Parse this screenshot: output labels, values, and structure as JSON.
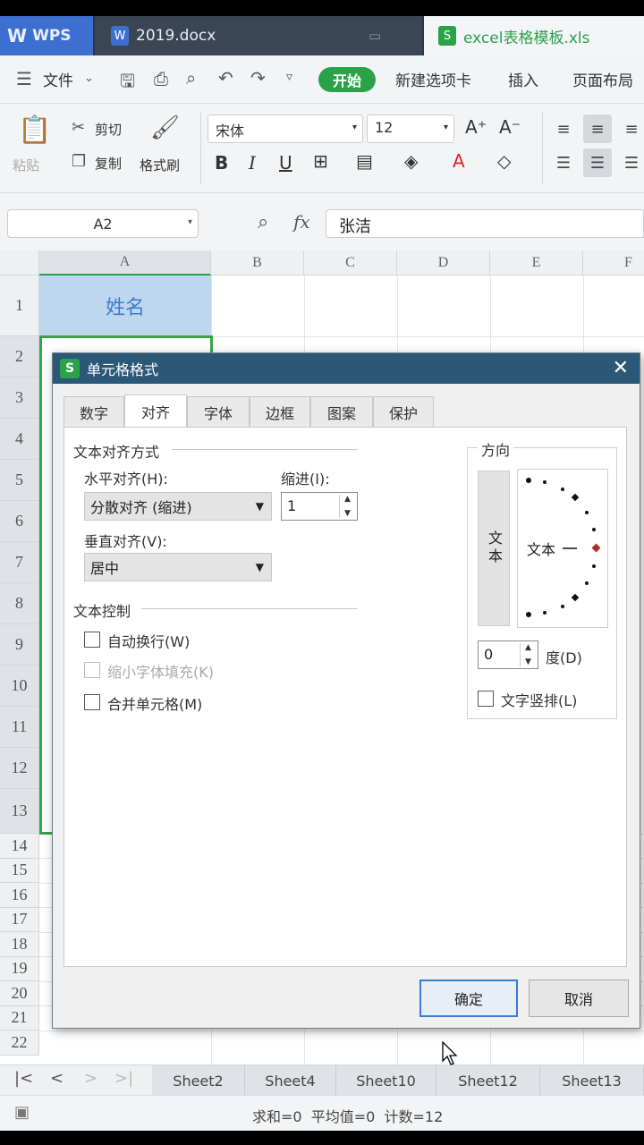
{
  "window_tabs": {
    "wps": "WPS",
    "docx": "2019.docx",
    "xls": "excel表格模板.xls"
  },
  "menubar": {
    "file": "文件",
    "start": "开始",
    "new_tab": "新建选项卡",
    "insert": "插入",
    "page_layout": "页面布局"
  },
  "toolbar": {
    "paste": "粘贴",
    "cut": "剪切",
    "copy": "复制",
    "format_painter": "格式刷",
    "font_name": "宋体",
    "font_size": "12",
    "bold": "B",
    "italic": "I",
    "underline": "U"
  },
  "formula_bar": {
    "cell_ref": "A2",
    "fx": "fx",
    "value": "张洁"
  },
  "sheet": {
    "columns": [
      "A",
      "B",
      "C",
      "D",
      "E",
      "F"
    ],
    "rows": [
      "1",
      "2",
      "3",
      "4",
      "5",
      "6",
      "7",
      "8",
      "9",
      "10",
      "11",
      "12",
      "13",
      "14",
      "15",
      "16",
      "17",
      "18",
      "19",
      "20",
      "21",
      "22"
    ],
    "a1": "姓名"
  },
  "sheet_tabs": [
    "Sheet2",
    "Sheet4",
    "Sheet10",
    "Sheet12",
    "Sheet13"
  ],
  "status": "求和=0  平均值=0  计数=12",
  "dialog": {
    "title": "单元格格式",
    "tabs": [
      "数字",
      "对齐",
      "字体",
      "边框",
      "图案",
      "保护"
    ],
    "text_align_group": "文本对齐方式",
    "h_align_label": "水平对齐(H):",
    "h_align_value": "分散对齐 (缩进)",
    "indent_label": "缩进(I):",
    "indent_value": "1",
    "v_align_label": "垂直对齐(V):",
    "v_align_value": "居中",
    "text_control_group": "文本控制",
    "wrap_text": "自动换行(W)",
    "shrink_fit": "缩小字体填充(K)",
    "merge_cells": "合并单元格(M)",
    "orientation_group": "方向",
    "vertical_text": "文本",
    "dial_text": "文本",
    "degrees_value": "0",
    "degrees_label": "度(D)",
    "vertical_layout": "文字竖排(L)",
    "ok": "确定",
    "cancel": "取消"
  },
  "colors": {
    "accent_green": "#2aa24a",
    "title_blue": "#2b5876",
    "header_fill": "#bdd7ee",
    "selection_border": "#3aa34a"
  }
}
